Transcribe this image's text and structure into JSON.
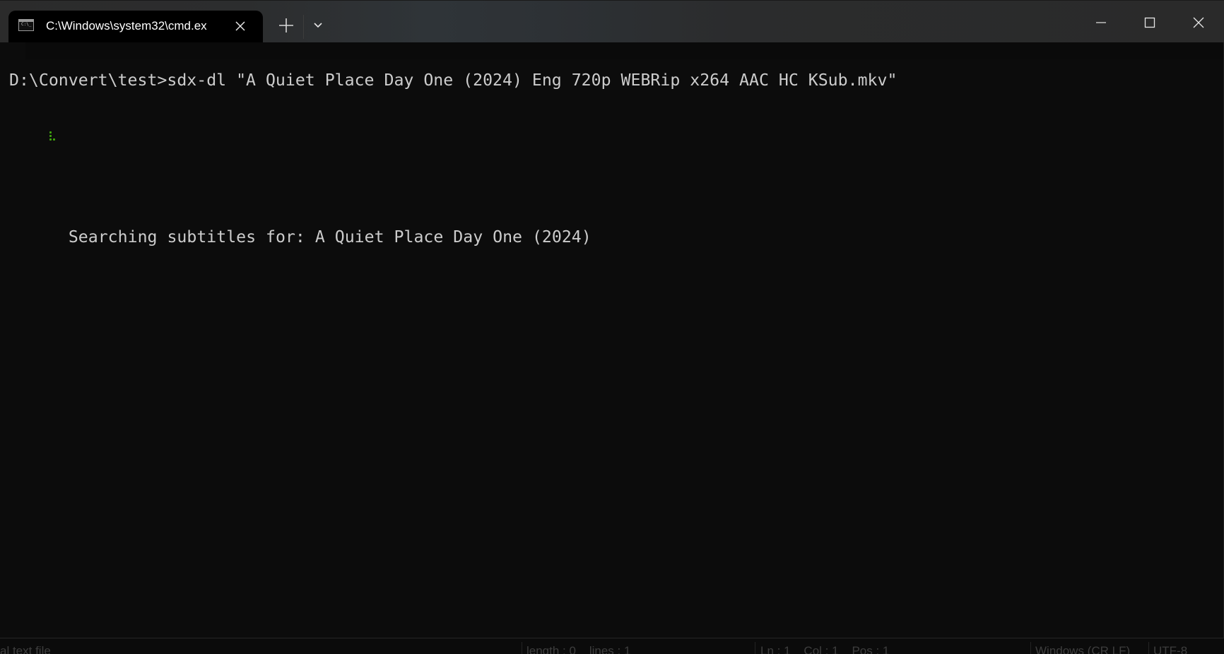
{
  "window": {
    "tab": {
      "title": "C:\\Windows\\system32\\cmd.ex",
      "icon": "terminal-icon",
      "icon_prompt": "C:\\_"
    },
    "controls": {
      "new_tab": "plus-icon",
      "dropdown": "chevron-down-icon",
      "minimize": "minimize-icon",
      "maximize": "maximize-icon",
      "close": "close-icon"
    }
  },
  "terminal": {
    "command_line": "D:\\Convert\\test>sdx-dl \"A Quiet Place Day One (2024) Eng 720p WEBRip x264 AAC HC KSub.mkv\"",
    "search_line": "Searching subtitles for: A Quiet Place Day One (2024)",
    "spinner_icon": "braille-spinner-icon",
    "colors": {
      "text": "#cccccc",
      "spinner": "#3fa30e",
      "background": "#0c0c0c"
    }
  },
  "statusbar": {
    "file_type": "al text file",
    "length_lines": "length : 0    lines : 1",
    "position": "Ln : 1    Col : 1    Pos : 1",
    "eol": "Windows (CR LF)",
    "encoding": "UTF-8"
  }
}
